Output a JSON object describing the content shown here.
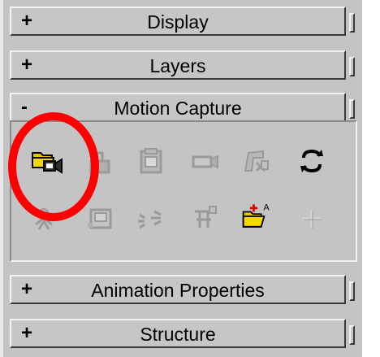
{
  "rollouts": {
    "display": {
      "sign": "+",
      "title": "Display"
    },
    "layers": {
      "sign": "+",
      "title": "Layers"
    },
    "motion_capture": {
      "sign": "-",
      "title": "Motion Capture"
    },
    "animation_properties": {
      "sign": "+",
      "title": "Animation Properties"
    },
    "structure": {
      "sign": "+",
      "title": "Structure"
    }
  },
  "toolbar_icons": {
    "row1": [
      "open-motion-capture-file-icon",
      "save-icon",
      "clipboard-icon",
      "camera-icon",
      "figure-mode-icon",
      "refresh-icon"
    ],
    "row2": [
      "bone-icon",
      "frame-icon",
      "footsteps-icon",
      "filter-icon",
      "add-folder-icon",
      "crosshair-icon"
    ]
  },
  "colors": {
    "panel_bg": "#c4c4c4",
    "highlight_circle": "#ff0000",
    "folder_yellow": "#e8c000",
    "disabled_icon": "#9a9a9a"
  }
}
